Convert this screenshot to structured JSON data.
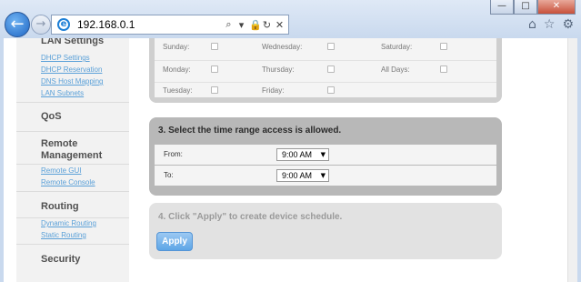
{
  "browser": {
    "url": "192.168.0.1",
    "window_controls": [
      "—",
      "□",
      "✕"
    ],
    "ie_icon": "ie-logo-icon"
  },
  "sidebar": {
    "sections": [
      {
        "heading": "LAN Settings",
        "links": [
          "DHCP Settings",
          "DHCP Reservation",
          "DNS Host Mapping",
          "LAN Subnets"
        ]
      },
      {
        "heading": "QoS",
        "links": []
      },
      {
        "heading": "Remote Management",
        "links": [
          "Remote GUI",
          "Remote Console"
        ]
      },
      {
        "heading": "Routing",
        "links": [
          "Dynamic Routing",
          "Static Routing"
        ]
      },
      {
        "heading": "Security",
        "links": []
      }
    ]
  },
  "days": {
    "sunday": "Sunday:",
    "monday": "Monday:",
    "tuesday": "Tuesday:",
    "wednesday": "Wednesday:",
    "thursday": "Thursday:",
    "friday": "Friday:",
    "saturday": "Saturday:",
    "all_days": "All Days:"
  },
  "time_range": {
    "title": "3. Select the time range access is allowed.",
    "from_label": "From:",
    "from_value": "9:00 AM",
    "to_label": "To:",
    "to_value": "9:00 AM"
  },
  "apply": {
    "text": "4. Click \"Apply\" to create device schedule.",
    "button_label": "Apply"
  }
}
